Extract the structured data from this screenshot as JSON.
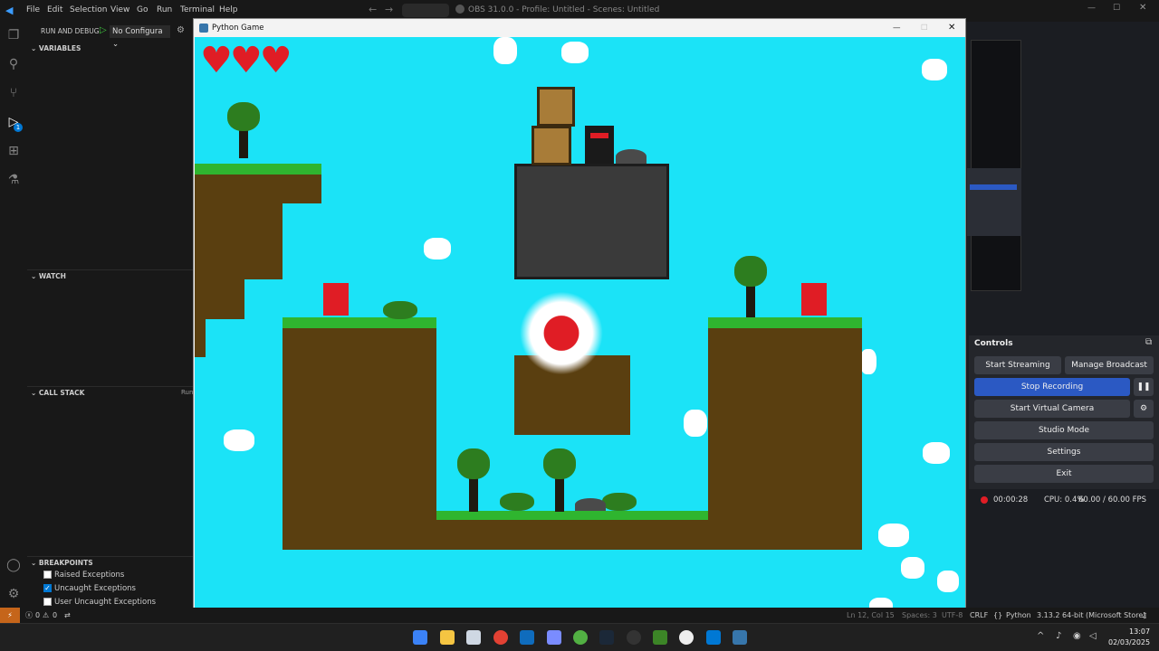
{
  "vscode": {
    "menu": [
      "File",
      "Edit",
      "Selection",
      "View",
      "Go",
      "Run",
      "Terminal",
      "Help"
    ],
    "run_debug_label": "RUN AND DEBUG",
    "config_select": "No Configura",
    "sections": {
      "variables": "VARIABLES",
      "watch": "WATCH",
      "call_stack": "CALL STACK",
      "breakpoints": "BREAKPOINTS"
    },
    "call_stack_trunc": "Run",
    "breakpoints": [
      {
        "label": "Raised Exceptions",
        "checked": false
      },
      {
        "label": "Uncaught Exceptions",
        "checked": true
      },
      {
        "label": "User Uncaught Exceptions",
        "checked": false
      }
    ],
    "status": {
      "errors": "0",
      "warnings": "0",
      "position": "Ln 12, Col 15",
      "spaces": "Spaces: 3",
      "encoding": "UTF-8",
      "eol": "CRLF",
      "language": "Python",
      "interpreter": "3.13.2 64-bit (Microsoft Store)"
    },
    "debug_badge": "1"
  },
  "obs_title": "OBS 31.0.0 - Profile: Untitled - Scenes: Untitled",
  "game": {
    "window_title": "Python Game",
    "hearts": 3
  },
  "obs": {
    "controls_title": "Controls",
    "buttons": {
      "start_streaming": "Start Streaming",
      "manage_broadcast": "Manage Broadcast",
      "stop_recording": "Stop Recording",
      "start_virtual_camera": "Start Virtual Camera",
      "studio_mode": "Studio Mode",
      "settings": "Settings",
      "exit": "Exit"
    },
    "rec_time": "00:00:28",
    "cpu": "CPU: 0.4%",
    "fps": "60.00 / 60.00 FPS"
  },
  "clock": {
    "time": "13:07",
    "date": "02/03/2025"
  },
  "colors": {
    "sky": "#1be3f7",
    "accent": "#2b59c3",
    "grass": "#2fb52f",
    "dirt": "#5a3f10",
    "heart": "#e01d25"
  }
}
